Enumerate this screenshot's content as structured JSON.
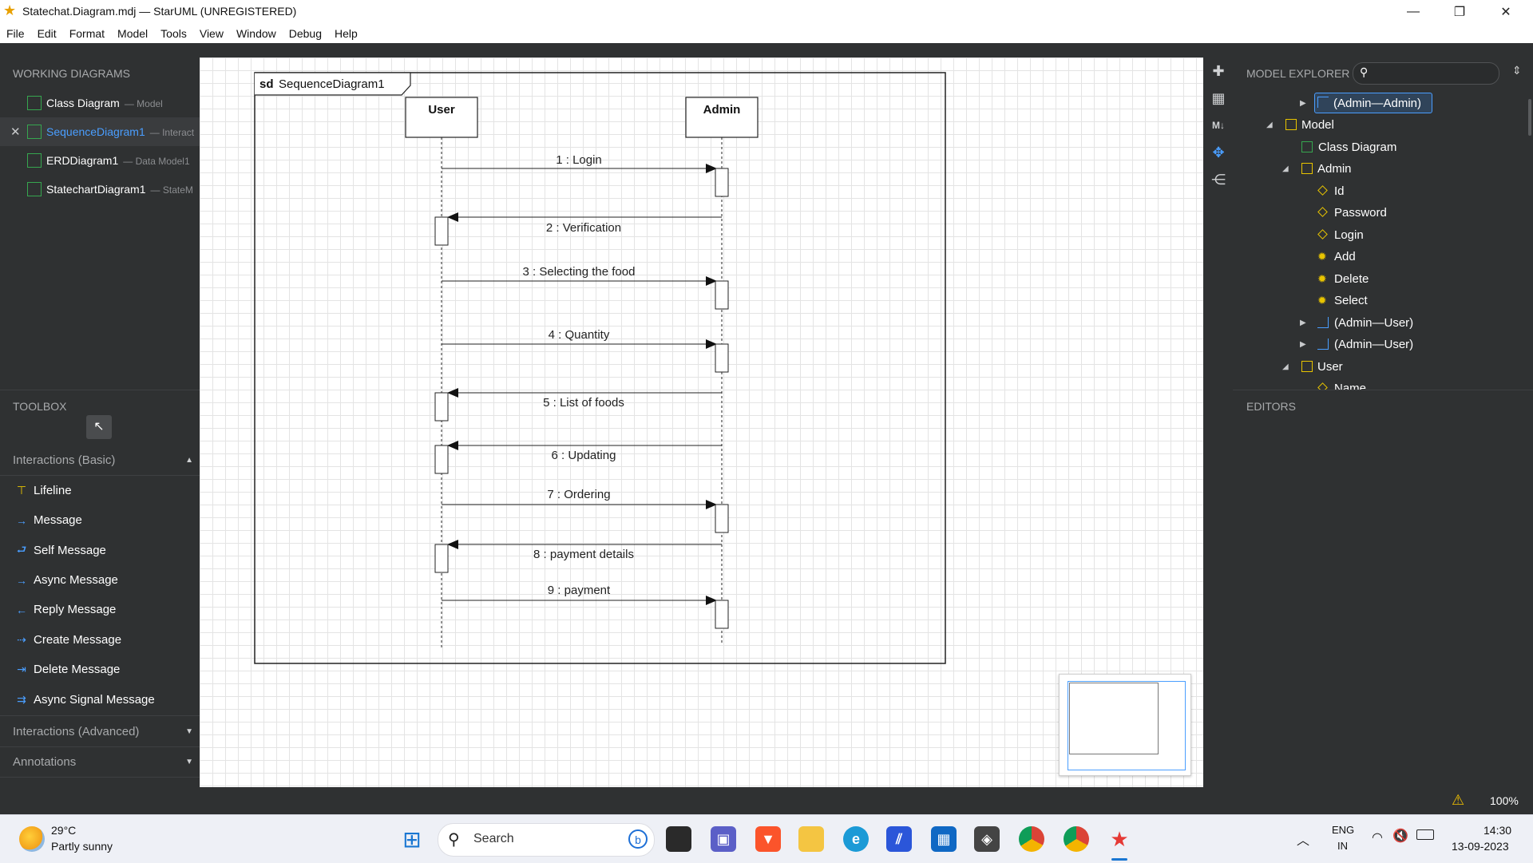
{
  "window": {
    "title": "Statechat.Diagram.mdj — StarUML (UNREGISTERED)",
    "controls": [
      "minimize",
      "restore",
      "close"
    ]
  },
  "menu": [
    "File",
    "Edit",
    "Format",
    "Model",
    "Tools",
    "View",
    "Window",
    "Debug",
    "Help"
  ],
  "working_diagrams": {
    "title": "WORKING DIAGRAMS",
    "items": [
      {
        "name": "Class Diagram",
        "sub": "— Model",
        "active": false
      },
      {
        "name": "SequenceDiagram1",
        "sub": "— Interact",
        "active": true
      },
      {
        "name": "ERDDiagram1",
        "sub": "— Data Model1",
        "active": false
      },
      {
        "name": "StatechartDiagram1",
        "sub": "— StateM",
        "active": false
      }
    ]
  },
  "toolbox": {
    "title": "TOOLBOX",
    "groups": [
      {
        "label": "Interactions (Basic)",
        "expanded": true
      },
      {
        "label": "Interactions (Advanced)",
        "expanded": false
      },
      {
        "label": "Annotations",
        "expanded": false
      }
    ],
    "items": [
      {
        "label": "Lifeline",
        "icon": "lifeline-icon"
      },
      {
        "label": "Message",
        "icon": "message-icon"
      },
      {
        "label": "Self Message",
        "icon": "self-message-icon"
      },
      {
        "label": "Async Message",
        "icon": "async-message-icon"
      },
      {
        "label": "Reply Message",
        "icon": "reply-message-icon"
      },
      {
        "label": "Create Message",
        "icon": "create-message-icon"
      },
      {
        "label": "Delete Message",
        "icon": "delete-message-icon"
      },
      {
        "label": "Async Signal Message",
        "icon": "async-signal-message-icon"
      }
    ]
  },
  "diagram": {
    "frame_keyword": "sd",
    "frame_name": "SequenceDiagram1",
    "lifelines": [
      "User",
      "Admin"
    ],
    "messages": [
      {
        "label": "1 : Login",
        "from": "User",
        "to": "Admin"
      },
      {
        "label": "2 : Verification",
        "from": "Admin",
        "to": "User"
      },
      {
        "label": "3 : Selecting the food",
        "from": "User",
        "to": "Admin"
      },
      {
        "label": "4 : Quantity",
        "from": "User",
        "to": "Admin"
      },
      {
        "label": "5 : List of foods",
        "from": "Admin",
        "to": "User"
      },
      {
        "label": "6 : Updating",
        "from": "Admin",
        "to": "User"
      },
      {
        "label": "7 : Ordering",
        "from": "User",
        "to": "Admin"
      },
      {
        "label": "8 : payment details",
        "from": "Admin",
        "to": "User"
      },
      {
        "label": "9 : payment",
        "from": "User",
        "to": "Admin"
      }
    ]
  },
  "model_explorer": {
    "title": "MODEL EXPLORER",
    "search_placeholder": "",
    "tree": [
      {
        "label": "(Admin—Admin)",
        "type": "association",
        "toggle": "collapsed",
        "selected": true
      },
      {
        "label": "Model",
        "type": "model",
        "toggle": "expanded"
      },
      {
        "label": "Class Diagram",
        "type": "diagram",
        "toggle": "none"
      },
      {
        "label": "Admin",
        "type": "class",
        "toggle": "expanded"
      },
      {
        "label": "Id",
        "type": "attribute",
        "toggle": "none"
      },
      {
        "label": "Password",
        "type": "attribute",
        "toggle": "none"
      },
      {
        "label": "Login",
        "type": "attribute",
        "toggle": "none"
      },
      {
        "label": "Add",
        "type": "operation",
        "toggle": "none"
      },
      {
        "label": "Delete",
        "type": "operation",
        "toggle": "none"
      },
      {
        "label": "Select",
        "type": "operation",
        "toggle": "none"
      },
      {
        "label": "(Admin—User)",
        "type": "association",
        "toggle": "collapsed"
      },
      {
        "label": "(Admin—User)",
        "type": "association",
        "toggle": "collapsed"
      },
      {
        "label": "User",
        "type": "class",
        "toggle": "expanded"
      },
      {
        "label": "Name",
        "type": "attribute",
        "toggle": "none"
      }
    ]
  },
  "editors": {
    "title": "EDITORS"
  },
  "status": {
    "zoom": "100%",
    "warning_icon": "warning-icon"
  },
  "taskbar": {
    "weather": {
      "temp": "29°C",
      "desc": "Partly sunny"
    },
    "search_label": "Search",
    "lang": "ENG",
    "region": "IN",
    "time": "14:30",
    "date": "13-09-2023"
  },
  "colors": {
    "panel": "#2f3132",
    "accent": "#4a9eff",
    "green": "#36a64f",
    "yellow": "#e8c400"
  }
}
